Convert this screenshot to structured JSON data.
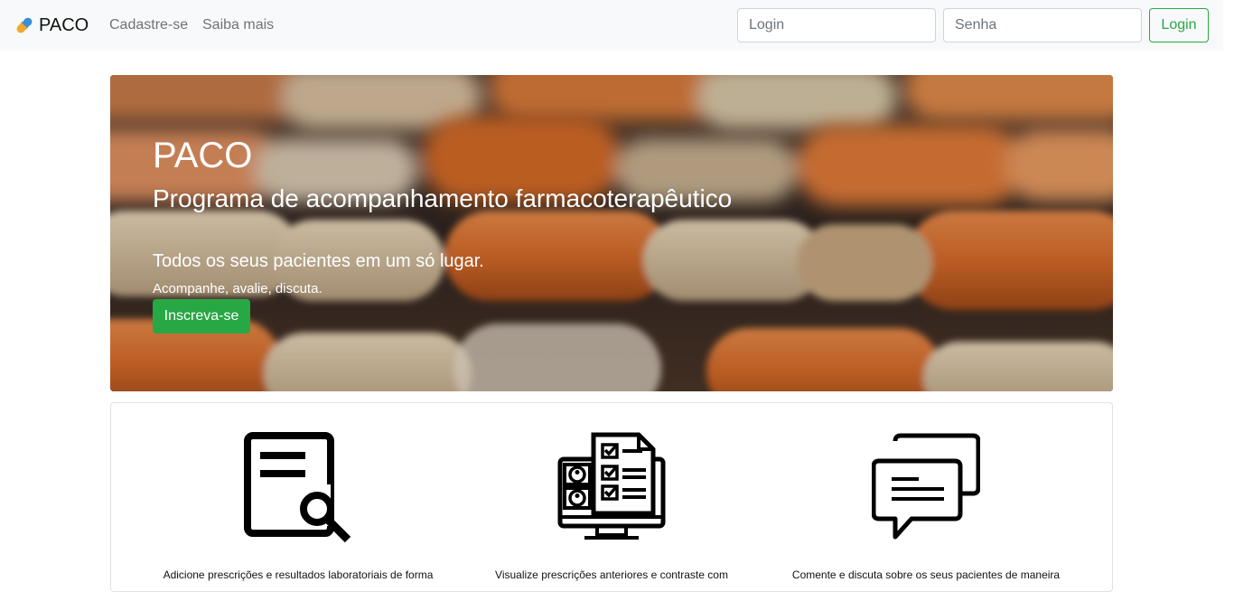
{
  "navbar": {
    "brand": "PACO",
    "links": [
      "Cadastre-se",
      "Saiba mais"
    ],
    "login_placeholder": "Login",
    "password_placeholder": "Senha",
    "login_button": "Login"
  },
  "hero": {
    "title": "PACO",
    "subtitle": "Programa de acompanhamento farmacoterapêutico",
    "lead": "Todos os seus pacientes em um só lugar.",
    "small": "Acompanhe, avalie, discuta.",
    "cta": "Inscreva-se"
  },
  "features": [
    {
      "icon": "document-search-icon",
      "text": "Adicione prescrições e resultados laboratoriais de forma"
    },
    {
      "icon": "monitor-checklist-icon",
      "text": "Visualize prescrições anteriores e contraste com"
    },
    {
      "icon": "chat-bubbles-icon",
      "text": "Comente e discuta sobre os seus pacientes de maneira"
    }
  ],
  "colors": {
    "primary_green": "#28a745",
    "navbar_bg": "#f8f9fa"
  }
}
